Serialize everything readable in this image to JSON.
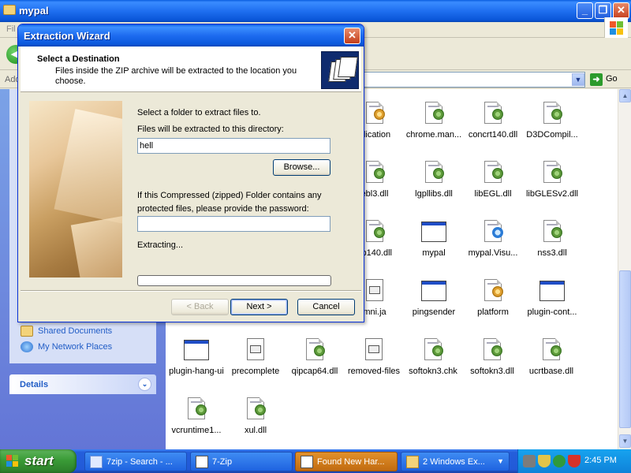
{
  "explorer": {
    "title": "mypal",
    "menu_fragment": "Fil",
    "address_label": "Addr",
    "go_label": "Go",
    "places": [
      "Shared Documents",
      "My Network Places"
    ],
    "details_label": "Details",
    "files": [
      {
        "name": "plication",
        "icon": "app-gear-icon"
      },
      {
        "name": "chrome.man...",
        "icon": "dll-icon"
      },
      {
        "name": "concrt140.dll",
        "icon": "dll-icon"
      },
      {
        "name": "D3DCompil...",
        "icon": "dll-icon"
      },
      {
        "name": "ebl3.dll",
        "icon": "dll-icon"
      },
      {
        "name": "lgpllibs.dll",
        "icon": "dll-icon"
      },
      {
        "name": "libEGL.dll",
        "icon": "dll-icon"
      },
      {
        "name": "libGLESv2.dll",
        "icon": "dll-icon"
      },
      {
        "name": "cp140.dll",
        "icon": "dll-icon"
      },
      {
        "name": "mypal",
        "icon": "app-window-icon"
      },
      {
        "name": "mypal.Visu...",
        "icon": "manifest-icon"
      },
      {
        "name": "nss3.dll",
        "icon": "dll-icon"
      },
      {
        "name": "mni.ja",
        "icon": "doc-icon"
      },
      {
        "name": "pingsender",
        "icon": "app-window-icon"
      },
      {
        "name": "platform",
        "icon": "config-icon"
      },
      {
        "name": "plugin-cont...",
        "icon": "app-window-icon"
      },
      {
        "name": "plugin-hang-ui",
        "icon": "app-window-icon"
      },
      {
        "name": "precomplete",
        "icon": "doc-icon"
      },
      {
        "name": "qipcap64.dll",
        "icon": "dll-icon"
      },
      {
        "name": "removed-files",
        "icon": "doc-icon"
      },
      {
        "name": "softokn3.chk",
        "icon": "dll-icon"
      },
      {
        "name": "softokn3.dll",
        "icon": "dll-icon"
      },
      {
        "name": "ucrtbase.dll",
        "icon": "dll-icon"
      },
      {
        "name": "vcruntime1...",
        "icon": "dll-icon"
      },
      {
        "name": "xul.dll",
        "icon": "dll-icon"
      }
    ]
  },
  "wizard": {
    "title": "Extraction Wizard",
    "heading": "Select a Destination",
    "subheading": "Files inside the ZIP archive will be extracted to the location you choose.",
    "select_folder_label": "Select a folder to extract files to.",
    "directory_label": "Files will be extracted to this directory:",
    "directory_value": "hell",
    "browse_label": "Browse...",
    "password_label_1": "If this Compressed (zipped) Folder contains any",
    "password_label_2": "protected files, please provide the password:",
    "password_value": "",
    "extracting_label": "Extracting...",
    "progress": 0,
    "back_label": "< Back",
    "next_label": "Next >",
    "cancel_label": "Cancel"
  },
  "taskbar": {
    "start_label": "start",
    "buttons": [
      "7zip - Search - ...",
      "7-Zip",
      "Found New Har...",
      "2 Windows Ex..."
    ],
    "clock": "2:45 PM"
  }
}
